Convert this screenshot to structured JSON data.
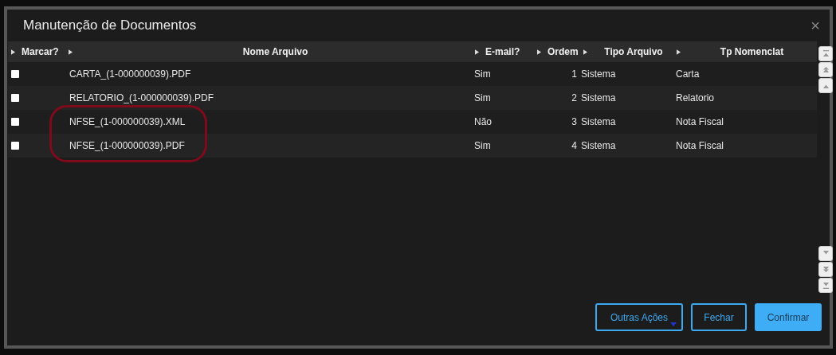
{
  "dialog": {
    "title": "Manutenção de Documentos",
    "close": "×"
  },
  "table": {
    "columns": [
      {
        "label": "Marcar?"
      },
      {
        "label": "Nome Arquivo"
      },
      {
        "label": "E-mail?"
      },
      {
        "label": "Ordem"
      },
      {
        "label": "Tipo Arquivo"
      },
      {
        "label": "Tp Nomenclat"
      }
    ],
    "rows": [
      {
        "checked": false,
        "file": "CARTA_(1-000000039).PDF",
        "email": "Sim",
        "order": "1",
        "type": "Sistema",
        "naming": "Carta",
        "highlighted": false
      },
      {
        "checked": false,
        "file": "RELATORIO_(1-000000039).PDF",
        "email": "Sim",
        "order": "2",
        "type": "Sistema",
        "naming": "Relatorio",
        "highlighted": false
      },
      {
        "checked": false,
        "file": "NFSE_(1-000000039).XML",
        "email": "Não",
        "order": "3",
        "type": "Sistema",
        "naming": "Nota Fiscal",
        "highlighted": true
      },
      {
        "checked": false,
        "file": "NFSE_(1-000000039).PDF",
        "email": "Sim",
        "order": "4",
        "type": "Sistema",
        "naming": "Nota Fiscal",
        "highlighted": true
      }
    ]
  },
  "buttons": [
    {
      "label": "Outras Ações",
      "kind": "dropdown"
    },
    {
      "label": "Fechar",
      "kind": "outline"
    },
    {
      "label": "Confirmar",
      "kind": "primary"
    }
  ]
}
